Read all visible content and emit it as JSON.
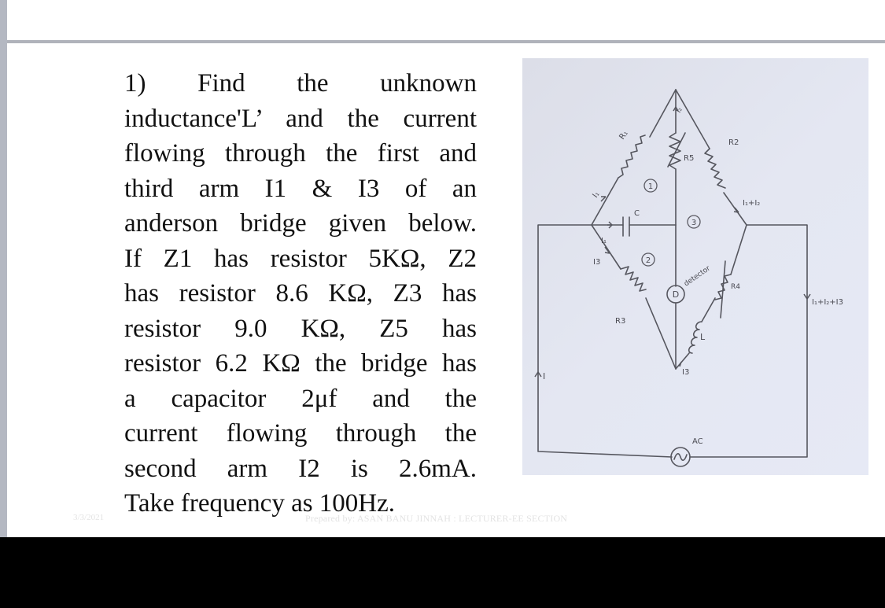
{
  "slide": {
    "problem_lines": [
      "1)    Find    the    unknown",
      "inductance'L’  and the current",
      "flowing through the first and",
      "third arm I1 & I3  of an",
      "anderson bridge  given below.",
      "If  Z1  has resistor 5KΩ, Z2",
      "has resistor 8.6 KΩ, Z3 has",
      "resistor  9.0  KΩ,  Z5  has",
      "resistor 6.2 KΩ the bridge has",
      "a capacitor 2μf and the",
      "current flowing through the",
      "second arm   I2 is 2.6mA.",
      "Take frequency as 100Hz."
    ],
    "footer_date": "3/3/2021",
    "footer_prepared": "Prepared by: ASAN BANU JINNAH : LECTURER-EE SECTION"
  },
  "diagram": {
    "labels": {
      "r1": "R₁",
      "r2": "R2",
      "r3": "R3",
      "r4": "R4",
      "r5": "R5",
      "c": "C",
      "l": "L",
      "i1": "I₁",
      "i1_cap": "I₁",
      "i2": "I₂",
      "i3": "I3",
      "i3_bottom": "I3",
      "i1_plus_i2": "I₁+I₂",
      "i_total": "I₁+I₂+I3",
      "i_source": "I",
      "detector_symbol": "D",
      "detector_text": "detector",
      "ac": "AC",
      "node1": "1",
      "node2": "2",
      "node3": "3"
    }
  }
}
